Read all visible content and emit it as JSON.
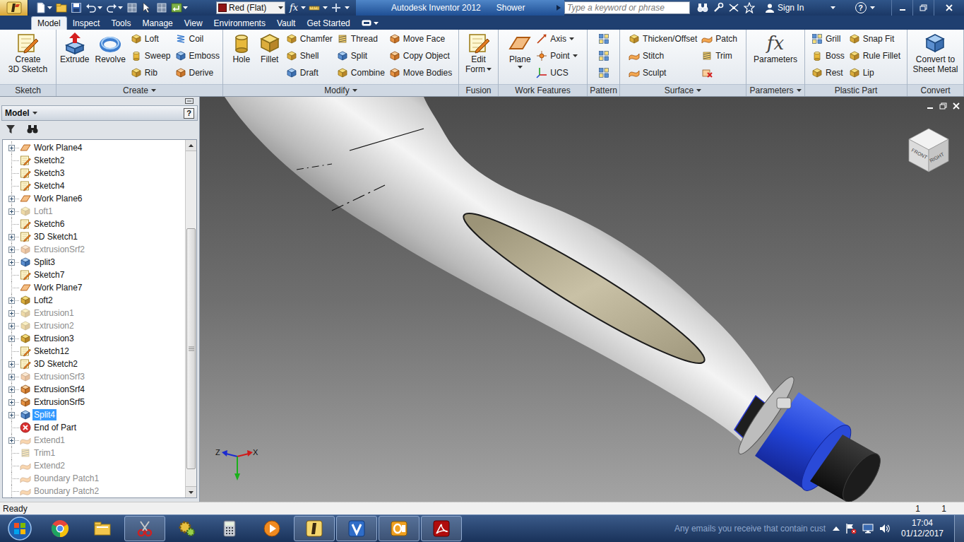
{
  "window": {
    "app": "Autodesk Inventor 2012",
    "document": "Shower"
  },
  "quick_access": {
    "material": "Red (Flat)",
    "formula": "fx"
  },
  "search": {
    "placeholder": "Type a keyword or phrase"
  },
  "account": {
    "sign_in": "Sign In",
    "help": "?"
  },
  "tabs": [
    {
      "label": "Model",
      "selected": true
    },
    {
      "label": "Inspect",
      "selected": false
    },
    {
      "label": "Tools",
      "selected": false
    },
    {
      "label": "Manage",
      "selected": false
    },
    {
      "label": "View",
      "selected": false
    },
    {
      "label": "Environments",
      "selected": false
    },
    {
      "label": "Vault",
      "selected": false
    },
    {
      "label": "Get Started",
      "selected": false
    }
  ],
  "ribbon": {
    "groups": [
      {
        "label": "Sketch",
        "dropdown": false,
        "tools": [
          {
            "lines": [
              "Create",
              "3D Sketch"
            ],
            "kind": "large",
            "dropdown": false
          }
        ]
      },
      {
        "label": "Create",
        "dropdown": true,
        "tools": [
          {
            "lines": [
              "Extrude"
            ],
            "kind": "large",
            "dropdown": false
          },
          {
            "lines": [
              "Revolve"
            ],
            "kind": "large",
            "dropdown": false
          },
          {
            "lines": [
              "Loft"
            ],
            "kind": "small",
            "dropdown": false
          },
          {
            "lines": [
              "Sweep"
            ],
            "kind": "small",
            "dropdown": false
          },
          {
            "lines": [
              "Rib"
            ],
            "kind": "small",
            "dropdown": false
          },
          {
            "lines": [
              "Coil"
            ],
            "kind": "small",
            "dropdown": false
          },
          {
            "lines": [
              "Emboss"
            ],
            "kind": "small",
            "dropdown": false
          },
          {
            "lines": [
              "Derive"
            ],
            "kind": "small",
            "dropdown": false
          }
        ]
      },
      {
        "label": "Modify",
        "dropdown": true,
        "tools": [
          {
            "lines": [
              "Hole"
            ],
            "kind": "large",
            "dropdown": false
          },
          {
            "lines": [
              "Fillet"
            ],
            "kind": "large",
            "dropdown": false
          },
          {
            "lines": [
              "Chamfer"
            ],
            "kind": "small",
            "dropdown": false
          },
          {
            "lines": [
              "Shell"
            ],
            "kind": "small",
            "dropdown": false
          },
          {
            "lines": [
              "Draft"
            ],
            "kind": "small",
            "dropdown": false
          },
          {
            "lines": [
              "Thread"
            ],
            "kind": "small",
            "dropdown": false
          },
          {
            "lines": [
              "Split"
            ],
            "kind": "small",
            "dropdown": false
          },
          {
            "lines": [
              "Combine"
            ],
            "kind": "small",
            "dropdown": false
          },
          {
            "lines": [
              "Move Face"
            ],
            "kind": "small",
            "dropdown": false
          },
          {
            "lines": [
              "Copy Object"
            ],
            "kind": "small",
            "dropdown": false
          },
          {
            "lines": [
              "Move Bodies"
            ],
            "kind": "small",
            "dropdown": false
          }
        ]
      },
      {
        "label": "Fusion",
        "dropdown": false,
        "tools": [
          {
            "lines": [
              "Edit",
              "Form"
            ],
            "kind": "large",
            "dropdown": true
          }
        ]
      },
      {
        "label": "Work Features",
        "dropdown": false,
        "tools": [
          {
            "lines": [
              "Plane"
            ],
            "kind": "large",
            "dropdown": true
          },
          {
            "lines": [
              "Axis"
            ],
            "kind": "small",
            "dropdown": true
          },
          {
            "lines": [
              "Point"
            ],
            "kind": "small",
            "dropdown": true
          },
          {
            "lines": [
              "UCS"
            ],
            "kind": "small",
            "dropdown": false
          }
        ]
      },
      {
        "label": "Pattern",
        "dropdown": false,
        "tools": [
          {
            "lines": [],
            "kind": "small",
            "dropdown": false
          },
          {
            "lines": [],
            "kind": "small",
            "dropdown": false
          },
          {
            "lines": [],
            "kind": "small",
            "dropdown": false
          }
        ]
      },
      {
        "label": "Surface",
        "dropdown": true,
        "tools": [
          {
            "lines": [
              "Thicken/Offset"
            ],
            "kind": "small",
            "dropdown": false
          },
          {
            "lines": [
              "Stitch"
            ],
            "kind": "small",
            "dropdown": false
          },
          {
            "lines": [
              "Sculpt"
            ],
            "kind": "small",
            "dropdown": false
          },
          {
            "lines": [
              "Patch"
            ],
            "kind": "small",
            "dropdown": false
          },
          {
            "lines": [
              "Trim"
            ],
            "kind": "small",
            "dropdown": false
          },
          {
            "lines": [],
            "kind": "small",
            "dropdown": false
          }
        ]
      },
      {
        "label": "Parameters",
        "dropdown": true,
        "tools": [
          {
            "lines": [
              "Parameters"
            ],
            "kind": "large",
            "dropdown": false,
            "glyph": "fx"
          }
        ]
      },
      {
        "label": "Plastic Part",
        "dropdown": false,
        "tools": [
          {
            "lines": [
              "Grill"
            ],
            "kind": "small",
            "dropdown": false
          },
          {
            "lines": [
              "Boss"
            ],
            "kind": "small",
            "dropdown": false
          },
          {
            "lines": [
              "Rest"
            ],
            "kind": "small",
            "dropdown": false
          },
          {
            "lines": [
              "Snap Fit"
            ],
            "kind": "small",
            "dropdown": false
          },
          {
            "lines": [
              "Rule Fillet"
            ],
            "kind": "small",
            "dropdown": false
          },
          {
            "lines": [
              "Lip"
            ],
            "kind": "small",
            "dropdown": false
          }
        ]
      },
      {
        "label": "Convert",
        "dropdown": false,
        "tools": [
          {
            "lines": [
              "Convert to",
              "Sheet Metal"
            ],
            "kind": "large",
            "dropdown": false
          }
        ]
      }
    ]
  },
  "browser": {
    "title": "Model",
    "title_dropdown": true,
    "help": "?",
    "scroll": {
      "offset": 0.23,
      "visible": 0.72
    },
    "items": [
      {
        "label": "Work Plane4",
        "kind": "workplane",
        "expandable": true,
        "greyed": false,
        "selected": false
      },
      {
        "label": "Sketch2",
        "kind": "sketch",
        "expandable": false,
        "greyed": false,
        "selected": false
      },
      {
        "label": "Sketch3",
        "kind": "sketch",
        "expandable": false,
        "greyed": false,
        "selected": false
      },
      {
        "label": "Sketch4",
        "kind": "sketch",
        "expandable": false,
        "greyed": false,
        "selected": false
      },
      {
        "label": "Work Plane6",
        "kind": "workplane",
        "expandable": true,
        "greyed": false,
        "selected": false
      },
      {
        "label": "Loft1",
        "kind": "loft",
        "expandable": true,
        "greyed": true,
        "selected": false
      },
      {
        "label": "Sketch6",
        "kind": "sketch",
        "expandable": false,
        "greyed": false,
        "selected": false
      },
      {
        "label": "3D Sketch1",
        "kind": "sketch3d",
        "expandable": true,
        "greyed": false,
        "selected": false
      },
      {
        "label": "ExtrusionSrf2",
        "kind": "surface",
        "expandable": true,
        "greyed": true,
        "selected": false
      },
      {
        "label": "Split3",
        "kind": "split",
        "expandable": true,
        "greyed": false,
        "selected": false
      },
      {
        "label": "Sketch7",
        "kind": "sketch",
        "expandable": false,
        "greyed": false,
        "selected": false
      },
      {
        "label": "Work Plane7",
        "kind": "workplane",
        "expandable": false,
        "greyed": false,
        "selected": false
      },
      {
        "label": "Loft2",
        "kind": "loft",
        "expandable": true,
        "greyed": false,
        "selected": false
      },
      {
        "label": "Extrusion1",
        "kind": "extrusion",
        "expandable": true,
        "greyed": true,
        "selected": false
      },
      {
        "label": "Extrusion2",
        "kind": "extrusion",
        "expandable": true,
        "greyed": true,
        "selected": false
      },
      {
        "label": "Extrusion3",
        "kind": "extrusion",
        "expandable": true,
        "greyed": false,
        "selected": false
      },
      {
        "label": "Sketch12",
        "kind": "sketch",
        "expandable": false,
        "greyed": false,
        "selected": false
      },
      {
        "label": "3D Sketch2",
        "kind": "sketch3d",
        "expandable": true,
        "greyed": false,
        "selected": false
      },
      {
        "label": "ExtrusionSrf3",
        "kind": "surface",
        "expandable": true,
        "greyed": true,
        "selected": false
      },
      {
        "label": "ExtrusionSrf4",
        "kind": "surface",
        "expandable": true,
        "greyed": false,
        "selected": false
      },
      {
        "label": "ExtrusionSrf5",
        "kind": "surface",
        "expandable": true,
        "greyed": false,
        "selected": false
      },
      {
        "label": "Split4",
        "kind": "split",
        "expandable": true,
        "greyed": false,
        "selected": true
      },
      {
        "label": "End of Part",
        "kind": "end",
        "expandable": false,
        "greyed": false,
        "selected": false
      },
      {
        "label": "Extend1",
        "kind": "extend",
        "expandable": true,
        "greyed": true,
        "selected": false
      },
      {
        "label": "Trim1",
        "kind": "trim",
        "expandable": false,
        "greyed": true,
        "selected": false
      },
      {
        "label": "Extend2",
        "kind": "extend",
        "expandable": false,
        "greyed": true,
        "selected": false
      },
      {
        "label": "Boundary Patch1",
        "kind": "patch",
        "expandable": false,
        "greyed": true,
        "selected": false
      },
      {
        "label": "Boundary Patch2",
        "kind": "patch",
        "expandable": false,
        "greyed": true,
        "selected": false
      }
    ]
  },
  "viewport": {
    "viewcube": [
      "FRONT",
      "RIGHT"
    ],
    "axes": [
      "Z",
      "X"
    ]
  },
  "status_bar": {
    "message": "Ready",
    "cells": [
      "1",
      "1"
    ]
  },
  "taskbar": {
    "apps": [
      {
        "running": false
      },
      {
        "running": false
      },
      {
        "running": true
      },
      {
        "running": false
      },
      {
        "running": false
      },
      {
        "running": false
      },
      {
        "running": true
      },
      {
        "running": true
      },
      {
        "running": true
      },
      {
        "running": true
      }
    ],
    "notification": "Any emails you receive that contain cust",
    "time": "17:04",
    "date": "01/12/2017"
  }
}
